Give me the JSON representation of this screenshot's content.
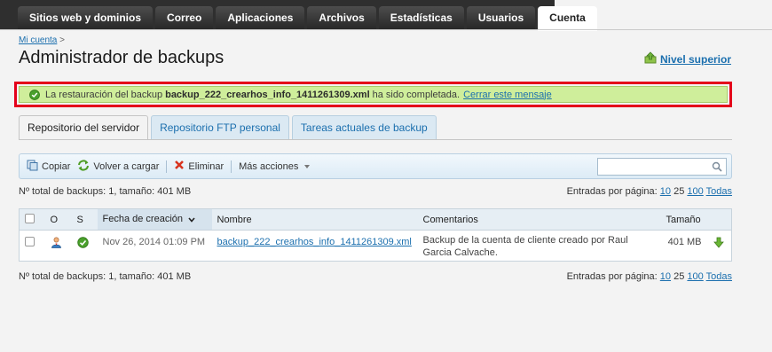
{
  "nav": {
    "tabs": [
      "Sitios web y dominios",
      "Correo",
      "Aplicaciones",
      "Archivos",
      "Estadísticas",
      "Usuarios",
      "Cuenta"
    ],
    "active": "Cuenta"
  },
  "breadcrumb": {
    "link": "Mi cuenta",
    "separator": ">"
  },
  "page_title": "Administrador de backups",
  "level_up": "Nivel superior",
  "notice": {
    "prefix": "La restauración del backup",
    "file": "backup_222_crearhos_info_1411261309.xml",
    "suffix": "ha sido completada.",
    "close": "Cerrar este mensaje"
  },
  "content_tabs": [
    "Repositorio del servidor",
    "Repositorio FTP personal",
    "Tareas actuales de backup"
  ],
  "toolbar": {
    "copy": "Copiar",
    "reload": "Volver a cargar",
    "delete": "Eliminar",
    "more": "Más acciones",
    "search_value": ""
  },
  "summary": "Nº total de backups: 1, tamaño: 401 MB",
  "pager": {
    "label": "Entradas por página:",
    "opt1": "10",
    "opt2": "25",
    "opt3": "100",
    "all": "Todas"
  },
  "table": {
    "headers": {
      "o": "O",
      "s": "S",
      "date": "Fecha de creación",
      "name": "Nombre",
      "comments": "Comentarios",
      "size": "Tamaño"
    },
    "rows": [
      {
        "date": "Nov 26, 2014 01:09 PM",
        "name": "backup_222_crearhos_info_1411261309.xml",
        "comment": "Backup de la cuenta de cliente creado por Raul Garcia Calvache.",
        "size": "401 MB"
      }
    ]
  },
  "colors": {
    "link": "#1b6fae",
    "success_bg": "#cfee9b",
    "highlight_border": "#e4001b",
    "nav_dark": "#2f2f2f"
  }
}
